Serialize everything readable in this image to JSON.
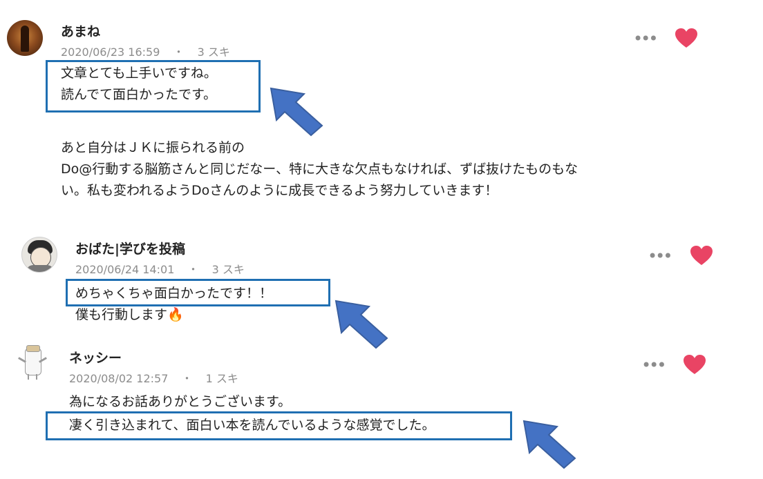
{
  "comments": [
    {
      "author": "あまね",
      "date": "2020/06/23 16:59",
      "separator": "・",
      "likes": "3 スキ",
      "lines": [
        "文章とても上手いですね。",
        "読んでて面白かったです。",
        "",
        "あと自分はＪＫに振られる前の",
        "Do@行動する脳筋さんと同じだなー、特に大きな欠点もなければ、ずば抜けたものもな",
        "い。私も変われるようDoさんのように成長できるよう努力していきます！"
      ]
    },
    {
      "author": "おばた|学びを投稿",
      "date": "2020/06/24 14:01",
      "separator": "・",
      "likes": "3 スキ",
      "lines": [
        "めちゃくちゃ面白かったです！！",
        "僕も行動します🔥"
      ]
    },
    {
      "author": "ネッシー",
      "date": "2020/08/02 12:57",
      "separator": "・",
      "likes": "1 スキ",
      "lines": [
        "為になるお話ありがとうございます。",
        "凄く引き込まれて、面白い本を読んでいるような感覚でした。"
      ]
    }
  ],
  "icons": {
    "more": "more-dots-icon",
    "like": "heart-icon",
    "annotation": "arrow-annotation"
  },
  "colors": {
    "heart": "#e94464",
    "highlight_box": "#1f6fb2",
    "arrow": "#4472c4",
    "meta_text": "#8c8c8c"
  }
}
